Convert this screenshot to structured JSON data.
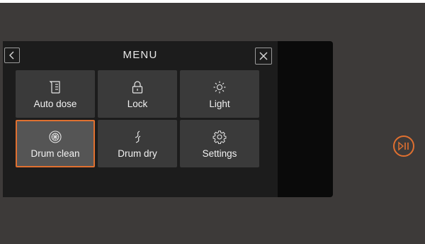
{
  "header": {
    "title": "MENU",
    "back_icon": "chevron-left-icon",
    "close_icon": "close-icon"
  },
  "menu": {
    "items": [
      {
        "label": "Auto dose",
        "icon": "detergent-container-icon"
      },
      {
        "label": "Lock",
        "icon": "lock-icon"
      },
      {
        "label": "Light",
        "icon": "sun-icon"
      },
      {
        "label": "Drum clean",
        "icon": "drum-icon",
        "selected": true
      },
      {
        "label": "Drum dry",
        "icon": "steam-icon"
      },
      {
        "label": "Settings",
        "icon": "gear-icon"
      }
    ]
  },
  "controls": {
    "play_pause_icon": "play-pause-icon"
  },
  "colors": {
    "accent": "#e07030",
    "tile": "#3a3a3a",
    "tile_selected": "#555555",
    "panel": "#1c1c1c",
    "body": "#3d3a39"
  }
}
